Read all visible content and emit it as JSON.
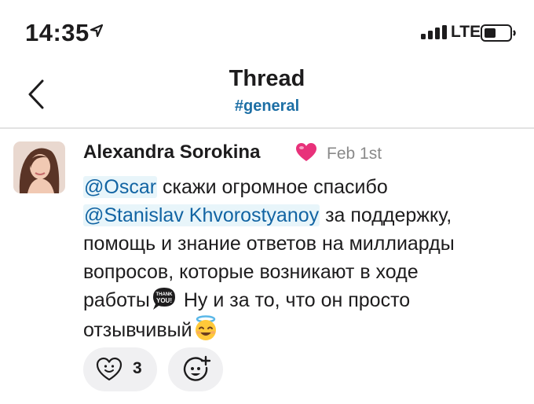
{
  "status_bar": {
    "time": "14:35",
    "network": "LTE",
    "icons": [
      "location-arrow-icon",
      "signal-icon",
      "battery-icon"
    ]
  },
  "header": {
    "title": "Thread",
    "channel": "#general",
    "back_icon": "chevron-left-icon"
  },
  "message": {
    "author": "Alexandra Sorokina",
    "status_emoji": "heart-icon",
    "date": "Feb 1st",
    "lines": {
      "l1": {
        "mention": "@Oscar",
        "text": " скажи огромное спасибо"
      },
      "l2": {
        "mention": "@Stanislav Khvorostyanoy",
        "text": " за поддержку,"
      },
      "l3": {
        "text": "помощь и знание ответов на миллиарды"
      },
      "l4": {
        "text": "вопросов, которые возникают в ходе"
      },
      "l5": {
        "text_before": "работы",
        "text_after": " Ну и за то, что он просто"
      },
      "l6": {
        "text": "отзывчивый"
      }
    },
    "emojis": [
      "thank-you-emoji",
      "innocent-smile-emoji"
    ]
  },
  "reactions": [
    {
      "icon": "heart-face-icon",
      "count": "3"
    },
    {
      "icon": "add-reaction-icon"
    }
  ],
  "colors": {
    "mention": "#1264a3",
    "mention_bg": "#e8f5fa",
    "channel": "#1d6fa5",
    "heart": "#e8317a"
  }
}
